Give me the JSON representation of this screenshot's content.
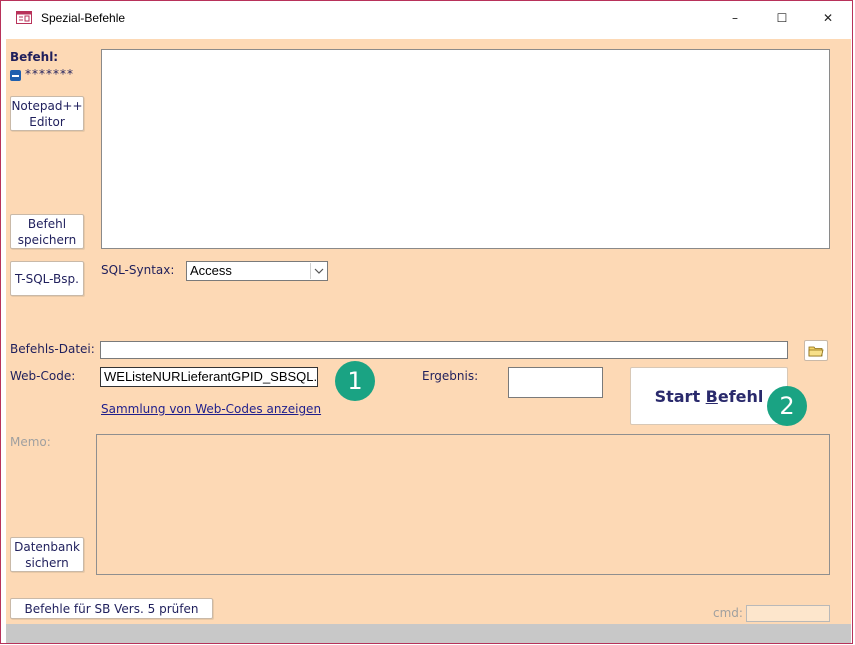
{
  "window": {
    "title": "Spezial-Befehle",
    "icon": "form-icon",
    "controls": {
      "minimize": "–",
      "maximize": "☐",
      "close": "✕"
    }
  },
  "left_panel": {
    "befehl_label": "Befehl:",
    "masked_text": "*******",
    "notepad_button": "Notepad++\nEditor",
    "save_button": "Befehl\nspeichern",
    "tsql_button": "T-SQL-Bsp.",
    "backup_button": "Datenbank\nsichern"
  },
  "sql_syntax": {
    "label": "SQL-Syntax:",
    "selected": "Access"
  },
  "befehls_datei": {
    "label": "Befehls-Datei:",
    "value": ""
  },
  "web_code": {
    "label": "Web-Code:",
    "value": "WEListeNURLieferantGPID_SBSQL.saf",
    "link": "Sammlung von Web-Codes anzeigen"
  },
  "ergebnis": {
    "label": "Ergebnis:",
    "value": ""
  },
  "start_button": {
    "prefix": "Start ",
    "accel": "B",
    "suffix": "efehl"
  },
  "memo": {
    "label": "Memo:"
  },
  "check_button": "Befehle für SB Vers. 5 prüfen",
  "cmd": {
    "label": "cmd:",
    "value": ""
  },
  "badges": {
    "one": "1",
    "two": "2"
  },
  "colors": {
    "form_background": "#fdd9b5",
    "label_text": "#1f1f5c",
    "badge": "#1aa383",
    "window_border": "#b8325a"
  }
}
